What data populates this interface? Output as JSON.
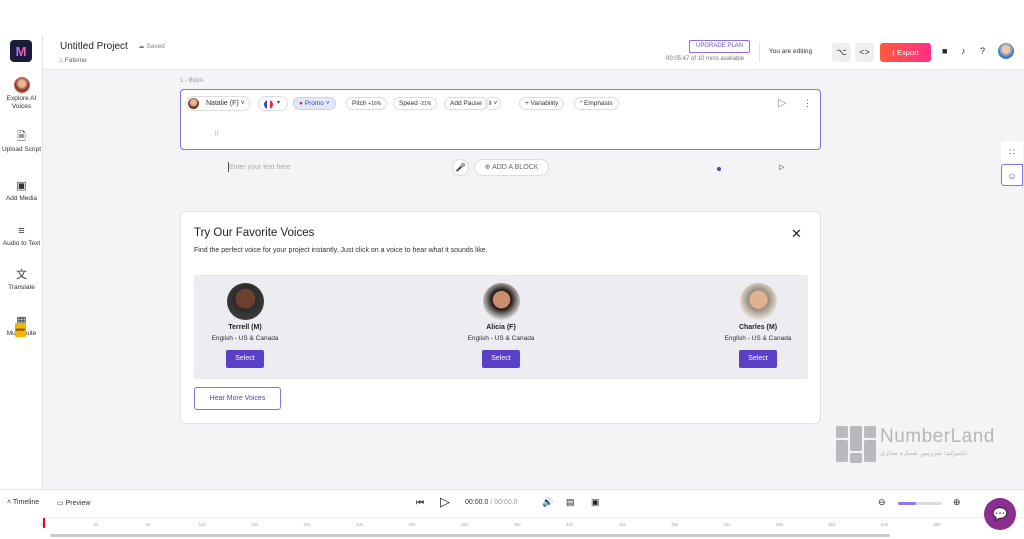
{
  "sidebar": {
    "items": [
      {
        "label": "Explore AI Voices",
        "icon": "avatar"
      },
      {
        "label": "Upload Script",
        "icon": "upload-file-icon"
      },
      {
        "label": "Add Media",
        "icon": "media-icon"
      },
      {
        "label": "Audio to Text",
        "icon": "audio-to-text-icon"
      },
      {
        "label": "Translate",
        "icon": "translate-icon"
      },
      {
        "label": "Murf Suite",
        "icon": "grid-icon",
        "badge": "NEW"
      }
    ]
  },
  "header": {
    "project_title": "Untitled Project",
    "saved": "Saved",
    "breadcrumb": "Fateme",
    "upgrade": "UPGRADE PLAN",
    "usage": "00:05:47 of 10 mins available",
    "editing": "You are editing",
    "export": "Export"
  },
  "block": {
    "label": "1 - Block",
    "voice": "Natalie (F)",
    "style": "Promo",
    "pitch_label": "Pitch",
    "pitch_value": "+16%",
    "speed_label": "Speed",
    "speed_value": "-21%",
    "add_pause": "Add Pause",
    "variability": "Variability",
    "emphasis": "Emphasis",
    "placeholder": "Enter your text here"
  },
  "add_block": "ADD A BLOCK",
  "favorites": {
    "title": "Try Our Favorite Voices",
    "description": "Find the perfect voice for your project instantly. Just click on a voice to hear what it sounds like.",
    "voices": [
      {
        "name": "Terrell (M)",
        "lang": "English - US & Canada",
        "select": "Select"
      },
      {
        "name": "Alicia (F)",
        "lang": "English - US & Canada",
        "select": "Select"
      },
      {
        "name": "Charles (M)",
        "lang": "English - US & Canada",
        "select": "Select"
      }
    ],
    "hear_more": "Hear More Voices"
  },
  "watermark": {
    "title": "NumberLand",
    "subtitle": "نامبرلند؛ سرزمین شماره مجازی!"
  },
  "bottom": {
    "timeline": "Timeline",
    "preview": "Preview",
    "current_time": "00:00.0",
    "duration": "/ 00:00.0",
    "zoom_level": 0.4,
    "ticks": [
      "0s",
      "4s",
      "8s",
      "12s",
      "16s",
      "20s",
      "24s",
      "28s",
      "32s",
      "36s",
      "40s",
      "44s",
      "48s",
      "52s",
      "56s",
      "60s",
      "64s",
      "68s"
    ]
  },
  "colors": {
    "accent": "#5b3fc9",
    "export_start": "#ff5a3c",
    "export_end": "#ff2f87"
  }
}
